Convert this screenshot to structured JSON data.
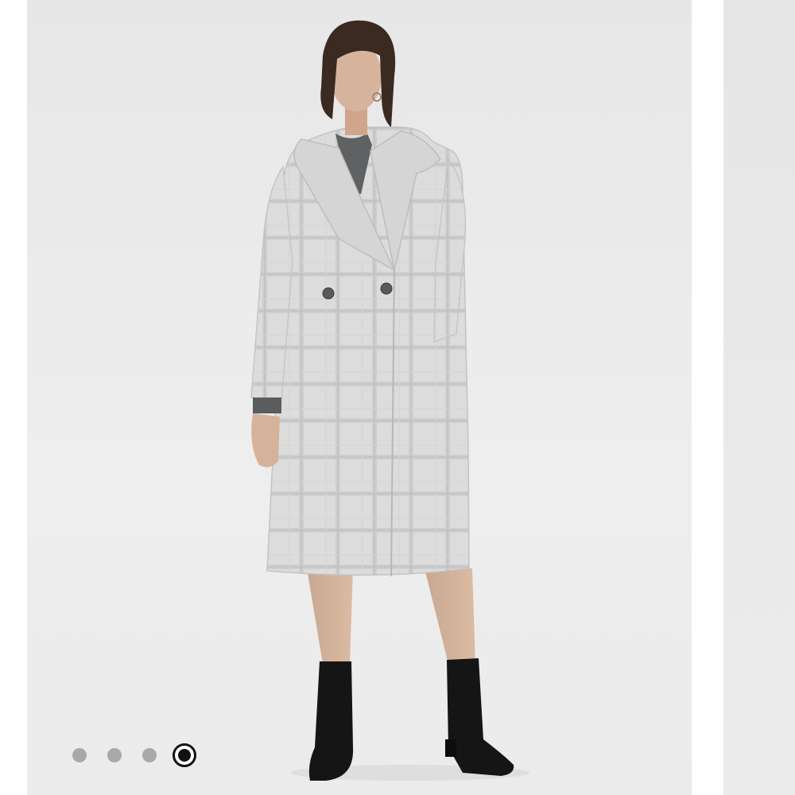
{
  "gallery": {
    "current_image_alt": "Model wearing a long light grey plaid double-breasted wool coat with a grey turtleneck and black ankle boots",
    "next_image_alt": "Next product photo (partially visible)",
    "page_count": 4,
    "active_page": 4,
    "dots": [
      {
        "state": "inactive"
      },
      {
        "state": "inactive"
      },
      {
        "state": "inactive"
      },
      {
        "state": "active"
      }
    ]
  },
  "colors": {
    "background": "#eeeeee",
    "coat": "#d9d9d9",
    "turtleneck": "#5f6163",
    "boots": "#151515",
    "dot_inactive": "#a9a9a9",
    "dot_active": "#111111"
  }
}
